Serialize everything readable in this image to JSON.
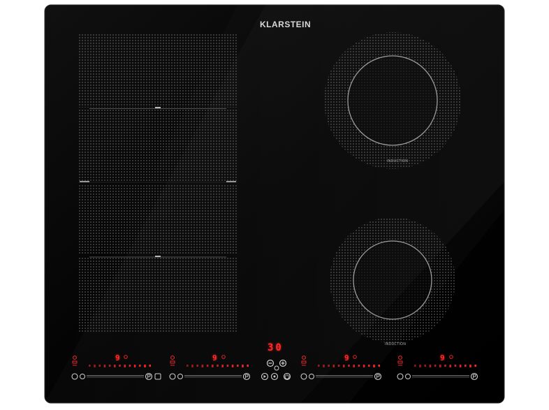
{
  "brand": "KLARSTEIN",
  "zone_labels": {
    "right_top": "INDUCTION",
    "right_bottom": "INDUCTION"
  },
  "timer_display": "30",
  "panels": [
    {
      "level": "9"
    },
    {
      "level": "9"
    },
    {
      "level": "9"
    },
    {
      "level": "9"
    }
  ],
  "colors": {
    "glass": "#050505",
    "pattern": "#5a5a5a",
    "led": "#ff2a2a",
    "control_icons": "#cfcfcf"
  }
}
